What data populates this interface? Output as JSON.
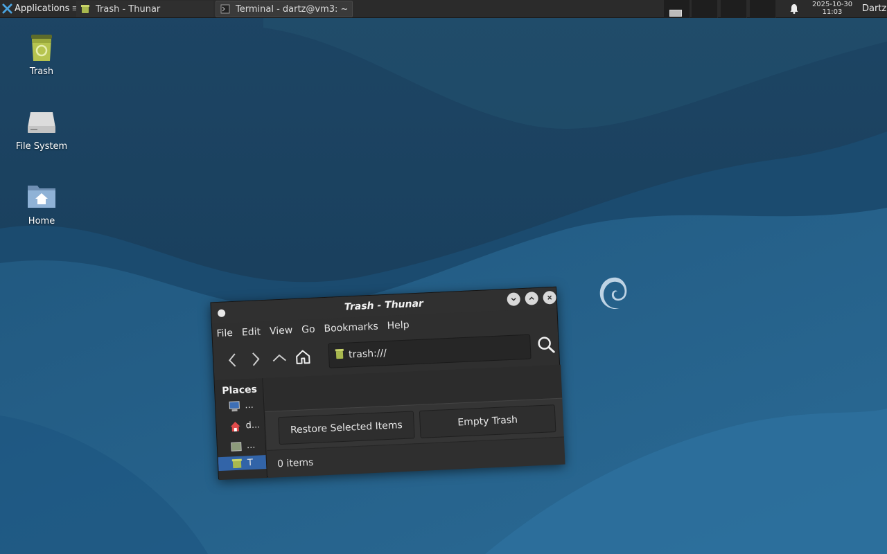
{
  "panel": {
    "applications_label": "Applications",
    "applications_sep": "≡",
    "tasks": [
      {
        "label": "Trash - Thunar",
        "icon": "trash-icon",
        "state": "active"
      },
      {
        "label": "Terminal - dartz@vm3: ~",
        "icon": "terminal-icon",
        "state": "inactive"
      }
    ],
    "clock_date": "2025-10-30",
    "clock_time": "11:03",
    "user": "Dartz",
    "notification_icon": "bell-icon"
  },
  "desktop": {
    "icons": [
      {
        "label": "Trash",
        "icon": "trash-icon"
      },
      {
        "label": "File System",
        "icon": "drive-icon"
      },
      {
        "label": "Home",
        "icon": "home-folder-icon"
      }
    ]
  },
  "window": {
    "title": "Trash - Thunar",
    "menu": [
      "File",
      "Edit",
      "View",
      "Go",
      "Bookmarks",
      "Help"
    ],
    "location": "trash:///",
    "sidebar": {
      "heading": "Places",
      "items": [
        {
          "label": "...",
          "icon": "computer-icon"
        },
        {
          "label": "d...",
          "icon": "home-icon"
        },
        {
          "label": "...",
          "icon": "desktop-icon"
        },
        {
          "label": "T",
          "icon": "trash-icon",
          "selected": true
        }
      ]
    },
    "buttons": {
      "restore": "Restore Selected Items",
      "empty": "Empty Trash"
    },
    "status": "0 items"
  },
  "colors": {
    "wallpaper_dark": "#123450",
    "wallpaper_mid": "#1f4e72",
    "wallpaper_light": "#2a6a96",
    "panel": "#2b2b2b",
    "selection": "#3264a8"
  }
}
